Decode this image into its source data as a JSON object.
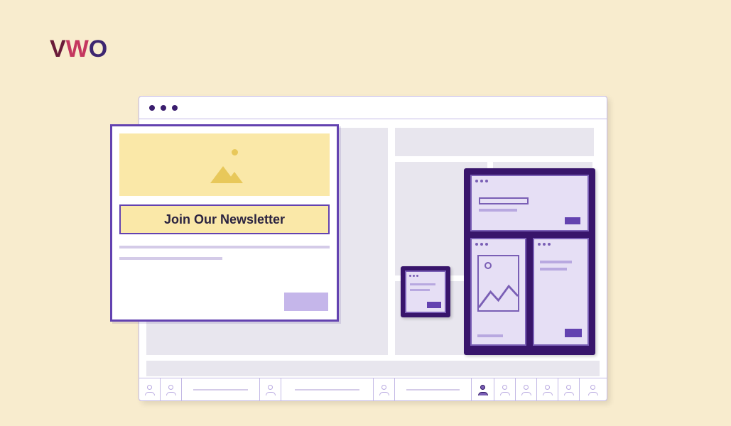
{
  "logo": {
    "v": "V",
    "w": "W",
    "o": "O"
  },
  "popup": {
    "cta": "Join Our Newsletter"
  }
}
